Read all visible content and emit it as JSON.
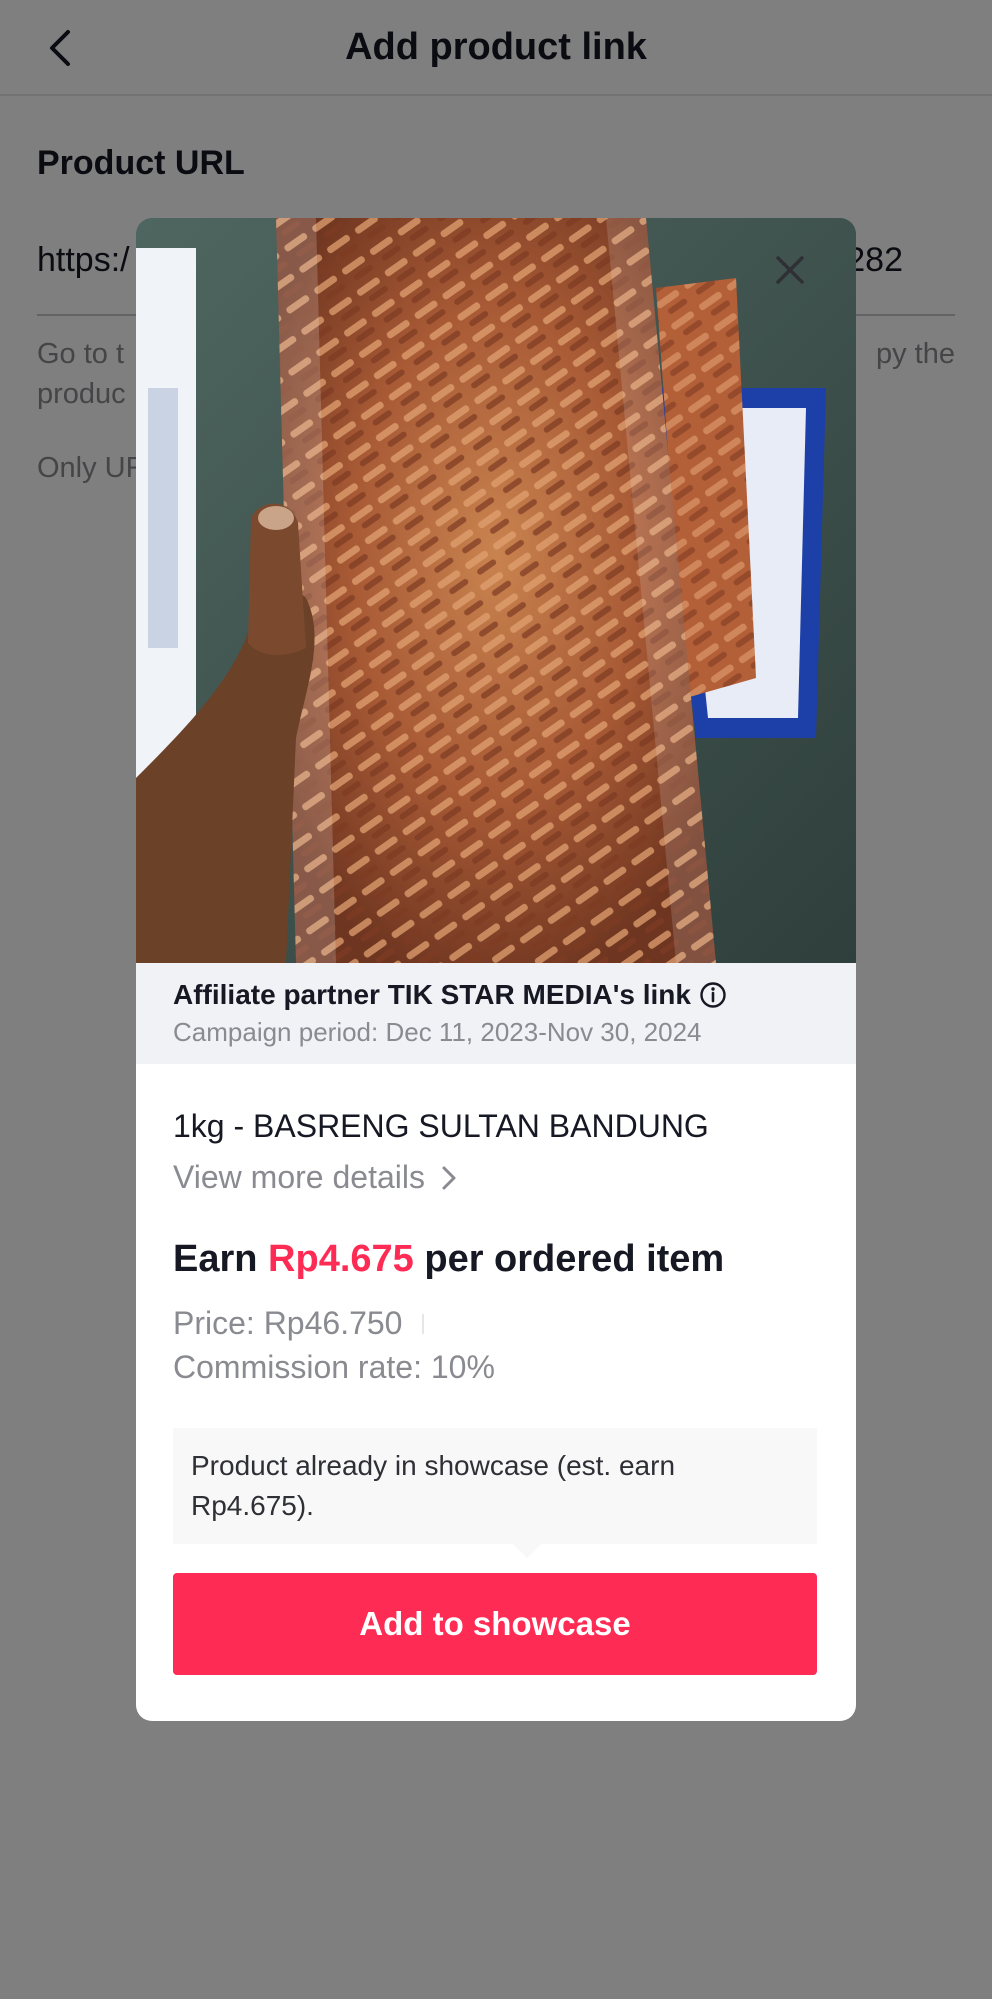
{
  "nav": {
    "title": "Add product link",
    "back_icon": "chevron-left-icon"
  },
  "form": {
    "label": "Product URL",
    "url_value_start": "https:/",
    "url_value_end": "282",
    "helper_line1_start": "Go to t",
    "helper_line1_end": "py the",
    "helper_line2_start": "produc",
    "note": "Only UR"
  },
  "modal": {
    "close_icon": "close-icon",
    "affiliate_title": "Affiliate partner TIK STAR MEDIA's link",
    "info_icon": "info-icon",
    "campaign_period": "Campaign period: Dec 11, 2023-Nov 30, 2024",
    "product_name": "1kg - BASRENG SULTAN BANDUNG",
    "details_link": "View more details",
    "earn_prefix": "Earn",
    "earn_amount": "Rp4.675",
    "earn_suffix": "per ordered item",
    "price": "Price: Rp46.750",
    "commission": "Commission rate: 10%",
    "notice": "Product already in showcase (est. earn Rp4.675).",
    "button_label": "Add to showcase"
  },
  "colors": {
    "accent": "#fe2c55",
    "text_primary": "#161823",
    "text_secondary": "#8a8b91",
    "banner_bg": "#f1f2f6"
  }
}
